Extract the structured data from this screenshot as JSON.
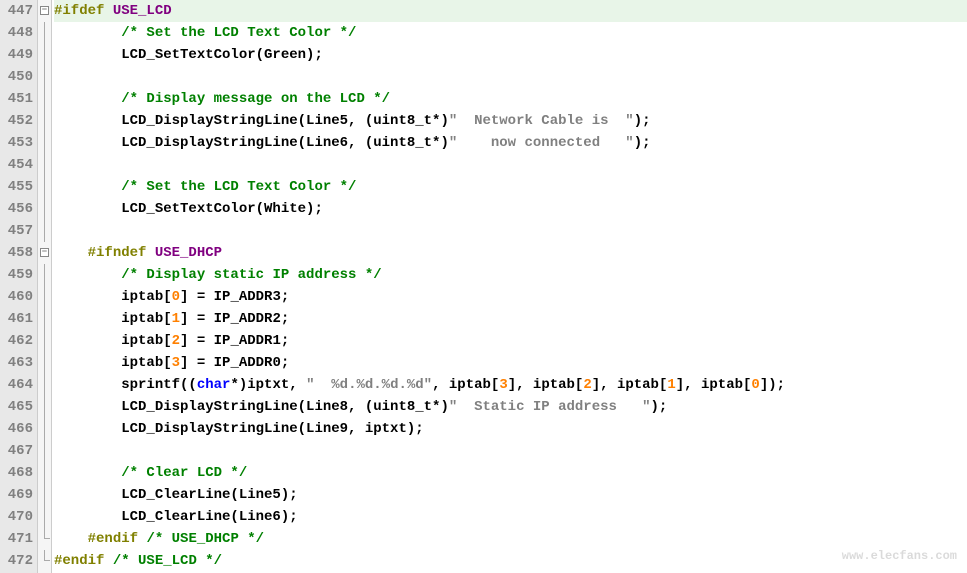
{
  "lines": [
    {
      "num": "447",
      "fold": "start",
      "highlight": true,
      "segments": [
        {
          "text": "#ifdef",
          "class": "preprocessor"
        },
        {
          "text": " USE_LCD",
          "class": "purple"
        }
      ]
    },
    {
      "num": "448",
      "fold": "line",
      "segments": [
        {
          "text": "        ",
          "class": ""
        },
        {
          "text": "/* Set the LCD Text Color */",
          "class": "comment"
        }
      ]
    },
    {
      "num": "449",
      "fold": "line",
      "segments": [
        {
          "text": "        LCD_SetTextColor(Green);",
          "class": "identifier"
        }
      ]
    },
    {
      "num": "450",
      "fold": "line",
      "segments": []
    },
    {
      "num": "451",
      "fold": "line",
      "segments": [
        {
          "text": "        ",
          "class": ""
        },
        {
          "text": "/* Display message on the LCD */",
          "class": "comment"
        }
      ]
    },
    {
      "num": "452",
      "fold": "line",
      "segments": [
        {
          "text": "        LCD_DisplayStringLine(Line5, (uint8_t*)",
          "class": "identifier"
        },
        {
          "text": "\"  Network Cable is  \"",
          "class": "string"
        },
        {
          "text": ");",
          "class": "identifier"
        }
      ]
    },
    {
      "num": "453",
      "fold": "line",
      "segments": [
        {
          "text": "        LCD_DisplayStringLine(Line6, (uint8_t*)",
          "class": "identifier"
        },
        {
          "text": "\"    now connected   \"",
          "class": "string"
        },
        {
          "text": ");",
          "class": "identifier"
        }
      ]
    },
    {
      "num": "454",
      "fold": "line",
      "segments": []
    },
    {
      "num": "455",
      "fold": "line",
      "segments": [
        {
          "text": "        ",
          "class": ""
        },
        {
          "text": "/* Set the LCD Text Color */",
          "class": "comment"
        }
      ]
    },
    {
      "num": "456",
      "fold": "line",
      "segments": [
        {
          "text": "        LCD_SetTextColor(White);",
          "class": "identifier"
        }
      ]
    },
    {
      "num": "457",
      "fold": "line",
      "segments": []
    },
    {
      "num": "458",
      "fold": "start2",
      "segments": [
        {
          "text": "    ",
          "class": ""
        },
        {
          "text": "#ifndef",
          "class": "preprocessor"
        },
        {
          "text": " USE_DHCP",
          "class": "purple"
        }
      ]
    },
    {
      "num": "459",
      "fold": "line",
      "segments": [
        {
          "text": "        ",
          "class": ""
        },
        {
          "text": "/* Display static IP address */",
          "class": "comment"
        }
      ]
    },
    {
      "num": "460",
      "fold": "line",
      "segments": [
        {
          "text": "        iptab[",
          "class": "identifier"
        },
        {
          "text": "0",
          "class": "number"
        },
        {
          "text": "] = IP_ADDR3;",
          "class": "identifier"
        }
      ]
    },
    {
      "num": "461",
      "fold": "line",
      "segments": [
        {
          "text": "        iptab[",
          "class": "identifier"
        },
        {
          "text": "1",
          "class": "number"
        },
        {
          "text": "] = IP_ADDR2;",
          "class": "identifier"
        }
      ]
    },
    {
      "num": "462",
      "fold": "line",
      "segments": [
        {
          "text": "        iptab[",
          "class": "identifier"
        },
        {
          "text": "2",
          "class": "number"
        },
        {
          "text": "] = IP_ADDR1;",
          "class": "identifier"
        }
      ]
    },
    {
      "num": "463",
      "fold": "line",
      "segments": [
        {
          "text": "        iptab[",
          "class": "identifier"
        },
        {
          "text": "3",
          "class": "number"
        },
        {
          "text": "] = IP_ADDR0;",
          "class": "identifier"
        }
      ]
    },
    {
      "num": "464",
      "fold": "line",
      "segments": [
        {
          "text": "        sprintf((",
          "class": "identifier"
        },
        {
          "text": "char",
          "class": "type"
        },
        {
          "text": "*)iptxt, ",
          "class": "identifier"
        },
        {
          "text": "\"  %d.%d.%d.%d\"",
          "class": "string"
        },
        {
          "text": ", iptab[",
          "class": "identifier"
        },
        {
          "text": "3",
          "class": "number"
        },
        {
          "text": "], iptab[",
          "class": "identifier"
        },
        {
          "text": "2",
          "class": "number"
        },
        {
          "text": "], iptab[",
          "class": "identifier"
        },
        {
          "text": "1",
          "class": "number"
        },
        {
          "text": "], iptab[",
          "class": "identifier"
        },
        {
          "text": "0",
          "class": "number"
        },
        {
          "text": "]);",
          "class": "identifier"
        }
      ]
    },
    {
      "num": "465",
      "fold": "line",
      "segments": [
        {
          "text": "        LCD_DisplayStringLine(Line8, (uint8_t*)",
          "class": "identifier"
        },
        {
          "text": "\"  Static IP address   \"",
          "class": "string"
        },
        {
          "text": ");",
          "class": "identifier"
        }
      ]
    },
    {
      "num": "466",
      "fold": "line",
      "segments": [
        {
          "text": "        LCD_DisplayStringLine(Line9, iptxt);",
          "class": "identifier"
        }
      ]
    },
    {
      "num": "467",
      "fold": "line",
      "segments": []
    },
    {
      "num": "468",
      "fold": "line",
      "segments": [
        {
          "text": "        ",
          "class": ""
        },
        {
          "text": "/* Clear LCD */",
          "class": "comment"
        }
      ]
    },
    {
      "num": "469",
      "fold": "line",
      "segments": [
        {
          "text": "        LCD_ClearLine(Line5);",
          "class": "identifier"
        }
      ]
    },
    {
      "num": "470",
      "fold": "line",
      "segments": [
        {
          "text": "        LCD_ClearLine(Line6);",
          "class": "identifier"
        }
      ]
    },
    {
      "num": "471",
      "fold": "end2",
      "segments": [
        {
          "text": "    ",
          "class": ""
        },
        {
          "text": "#endif",
          "class": "preprocessor"
        },
        {
          "text": " ",
          "class": ""
        },
        {
          "text": "/* USE_DHCP */",
          "class": "comment"
        }
      ]
    },
    {
      "num": "472",
      "fold": "end",
      "segments": [
        {
          "text": "#endif",
          "class": "preprocessor"
        },
        {
          "text": " ",
          "class": ""
        },
        {
          "text": "/* USE_LCD */",
          "class": "comment"
        }
      ]
    }
  ],
  "watermark": "www.elecfans.com"
}
